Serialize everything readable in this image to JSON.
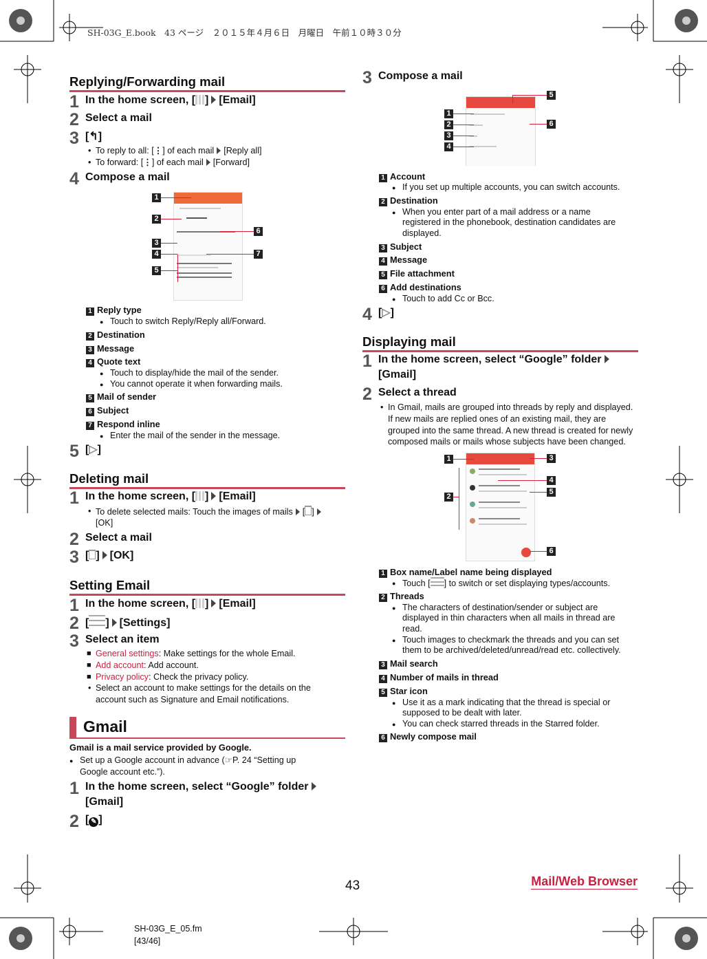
{
  "header": {
    "book_line": "SH-03G_E.book　43 ページ　２０１５年４月６日　月曜日　午前１０時３０分"
  },
  "left": {
    "reply": {
      "title": "Replying/Forwarding mail",
      "s1": {
        "n": "1",
        "pre": "In the home screen, [",
        "post": "]",
        "target": "[Email]"
      },
      "s2": {
        "n": "2",
        "text": "Select a mail"
      },
      "s3": {
        "n": "3",
        "pre": "[",
        "post": "]"
      },
      "b1": {
        "pre": "To reply to all: [",
        "mid": "] of each mail",
        "post": "[Reply all]"
      },
      "b2": {
        "pre": "To forward: [",
        "mid": "] of each mail",
        "post": "[Forward]"
      },
      "s4": {
        "n": "4",
        "text": "Compose a mail"
      },
      "legend": [
        {
          "n": "1",
          "label": "Reply type",
          "notes": [
            "Touch to switch Reply/Reply all/Forward."
          ]
        },
        {
          "n": "2",
          "label": "Destination",
          "notes": []
        },
        {
          "n": "3",
          "label": "Message",
          "notes": []
        },
        {
          "n": "4",
          "label": "Quote text",
          "notes": [
            "Touch to display/hide the mail of the sender.",
            "You cannot operate it when forwarding mails."
          ]
        },
        {
          "n": "5",
          "label": "Mail of sender",
          "notes": []
        },
        {
          "n": "6",
          "label": "Subject",
          "notes": []
        },
        {
          "n": "7",
          "label": "Respond inline",
          "notes": [
            "Enter the mail of the sender in the message."
          ]
        }
      ],
      "s5": {
        "n": "5",
        "pre": "[",
        "post": "]"
      }
    },
    "delete": {
      "title": "Deleting mail",
      "s1": {
        "n": "1",
        "pre": "In the home screen, [",
        "post": "]",
        "target": "[Email]"
      },
      "b1": {
        "pre": "To delete selected mails: Touch the images of mails",
        "mid1": "[",
        "mid2": "]",
        "post": "[OK]"
      },
      "s2": {
        "n": "2",
        "text": "Select a mail"
      },
      "s3": {
        "n": "3",
        "pre": "[",
        "post": "]",
        "target": "[OK]"
      }
    },
    "settings": {
      "title": "Setting Email",
      "s1": {
        "n": "1",
        "pre": "In the home screen, [",
        "post": "]",
        "target": "[Email]"
      },
      "s2": {
        "n": "2",
        "pre": "[",
        "post": "]",
        "target": "[Settings]"
      },
      "s3": {
        "n": "3",
        "text": "Select an item"
      },
      "items": [
        {
          "name": "General settings",
          "desc": ": Make settings for the whole Email."
        },
        {
          "name": "Add account",
          "desc": ": Add account."
        },
        {
          "name": "Privacy policy",
          "desc": ": Check the privacy policy."
        }
      ],
      "note": [
        "Select an account to make settings for the details on the",
        "account such as Signature and Email notifications."
      ]
    },
    "gmail": {
      "title": "Gmail",
      "intro": "Gmail is a mail service provided by Google.",
      "bullet": [
        "Set up a Google account in advance (☞P. 24 “Setting up",
        "Google account etc.”)."
      ],
      "s1": {
        "n": "1",
        "line1": "In the home screen, select “Google” folder",
        "line2": "[Gmail]"
      },
      "s2": {
        "n": "2",
        "pre": "[",
        "post": "]"
      }
    }
  },
  "right": {
    "compose": {
      "s3": {
        "n": "3",
        "text": "Compose a mail"
      },
      "legend": [
        {
          "n": "1",
          "label": "Account",
          "notes": [
            "If you set up multiple accounts, you can switch accounts."
          ]
        },
        {
          "n": "2",
          "label": "Destination",
          "notes": [
            "When you enter part of a mail address or a name",
            "registered in the phonebook, destination candidates are",
            "displayed."
          ]
        },
        {
          "n": "3",
          "label": "Subject"
        },
        {
          "n": "4",
          "label": "Message"
        },
        {
          "n": "5",
          "label": "File attachment"
        },
        {
          "n": "6",
          "label": "Add destinations",
          "notes": [
            "Touch to add Cc or Bcc."
          ]
        }
      ],
      "s4": {
        "n": "4",
        "pre": "[",
        "post": "]"
      }
    },
    "display": {
      "title": "Displaying mail",
      "s1": {
        "n": "1",
        "line1": "In the home screen, select “Google” folder",
        "line2": "[Gmail]"
      },
      "s2": {
        "n": "2",
        "text": "Select a thread"
      },
      "note": [
        "In Gmail, mails are grouped into threads by reply and displayed.",
        "If new mails are replied ones of an existing mail, they are",
        "grouped into the same thread. A new thread is created for newly",
        "composed mails or mails whose subjects have been changed."
      ],
      "legend": [
        {
          "n": "1",
          "label": "Box name/Label name being displayed",
          "pre": "Touch [",
          "post": "] to switch or set displaying types/accounts."
        },
        {
          "n": "2",
          "label": "Threads",
          "notes1": [
            "The characters of destination/sender or subject are",
            "displayed in thin characters when all mails in thread are",
            "read."
          ],
          "notes2": [
            "Touch images to checkmark the threads and you can set",
            "them to be archived/deleted/unread/read etc. collectively."
          ]
        },
        {
          "n": "3",
          "label": "Mail search"
        },
        {
          "n": "4",
          "label": "Number of mails in thread"
        },
        {
          "n": "5",
          "label": "Star icon",
          "notes1": [
            "Use it as a mark indicating that the thread is special or",
            "supposed to be dealt with later."
          ],
          "notes2": [
            "You can check starred threads in the Starred folder."
          ]
        },
        {
          "n": "6",
          "label": "Newly compose mail"
        }
      ]
    }
  },
  "footer": {
    "page": "43",
    "section": "Mail/Web Browser",
    "file": "SH-03G_E_05.fm",
    "pages": "[43/46]"
  },
  "colors": {
    "accent": "#c8475a",
    "link": "#c8203e",
    "app_bar": "#e8493e"
  }
}
